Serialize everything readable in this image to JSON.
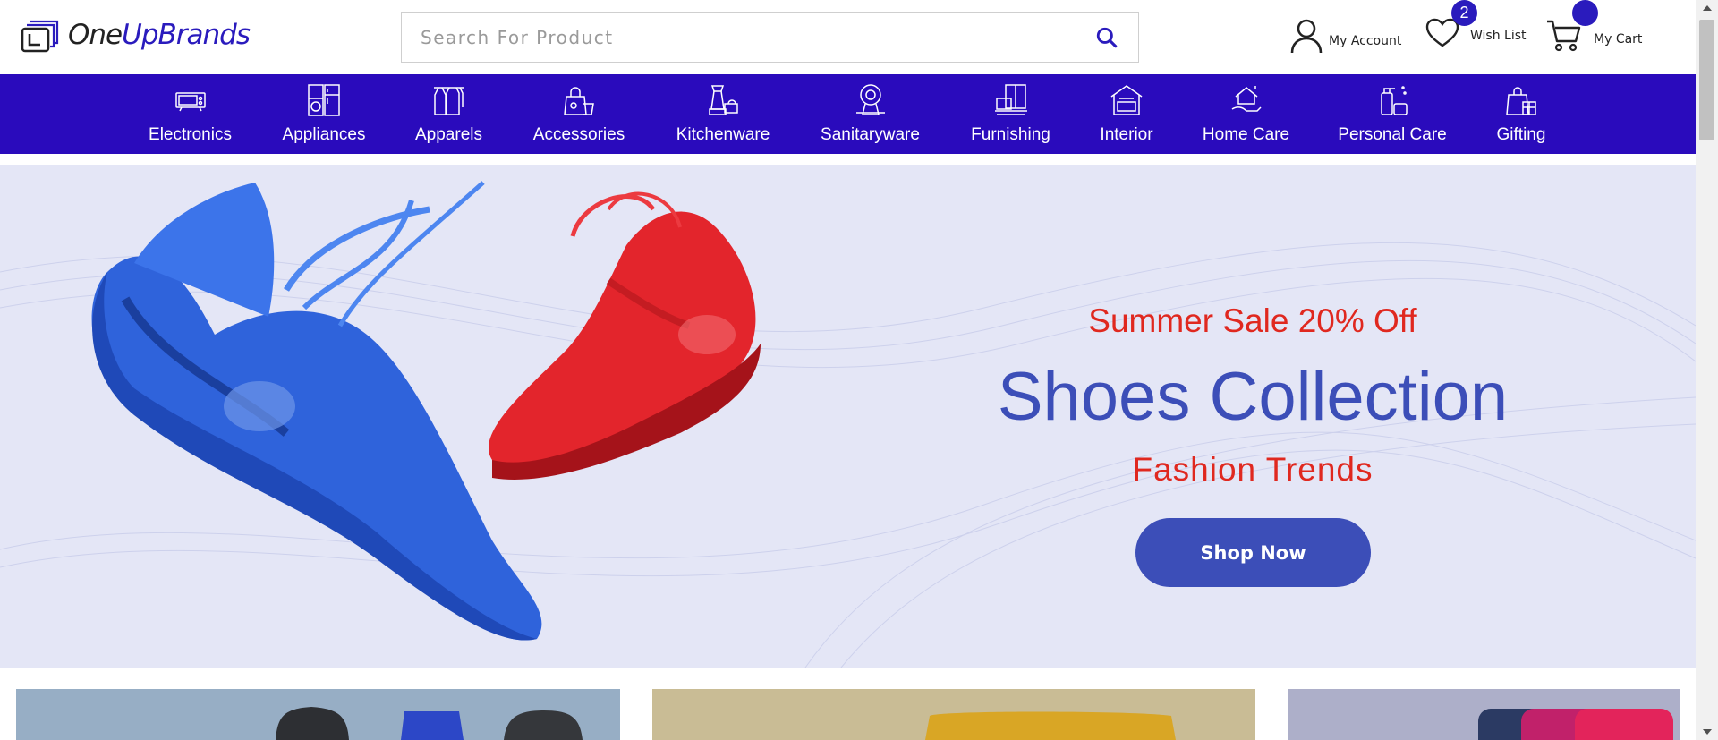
{
  "header": {
    "logo": {
      "text_one": "One",
      "text_up": "Up",
      "text_brands": "Brands"
    },
    "search": {
      "placeholder": "Search For Product",
      "value": ""
    },
    "account_label": "My Account",
    "wishlist_label": "Wish List",
    "wishlist_count": "2",
    "cart_label": "My Cart",
    "cart_count": ""
  },
  "nav": {
    "items": [
      {
        "label": "Electronics",
        "icon": "electronics-icon"
      },
      {
        "label": "Appliances",
        "icon": "appliances-icon"
      },
      {
        "label": "Apparels",
        "icon": "apparels-icon"
      },
      {
        "label": "Accessories",
        "icon": "accessories-icon"
      },
      {
        "label": "Kitchenware",
        "icon": "kitchenware-icon"
      },
      {
        "label": "Sanitaryware",
        "icon": "sanitaryware-icon"
      },
      {
        "label": "Furnishing",
        "icon": "furnishing-icon"
      },
      {
        "label": "Interior",
        "icon": "interior-icon"
      },
      {
        "label": "Home Care",
        "icon": "home-care-icon"
      },
      {
        "label": "Personal Care",
        "icon": "personal-care-icon"
      },
      {
        "label": "Gifting",
        "icon": "gifting-icon"
      }
    ]
  },
  "hero": {
    "sale_text": "Summer Sale 20% Off",
    "title": "Shoes Collection",
    "subtitle": "Fashion Trends",
    "button_label": "Shop Now"
  },
  "colors": {
    "brand": "#2a0bbc",
    "hero_background": "#e4e6f6",
    "hero_accent": "#3c4eb8",
    "sale_red": "#e0281f"
  }
}
